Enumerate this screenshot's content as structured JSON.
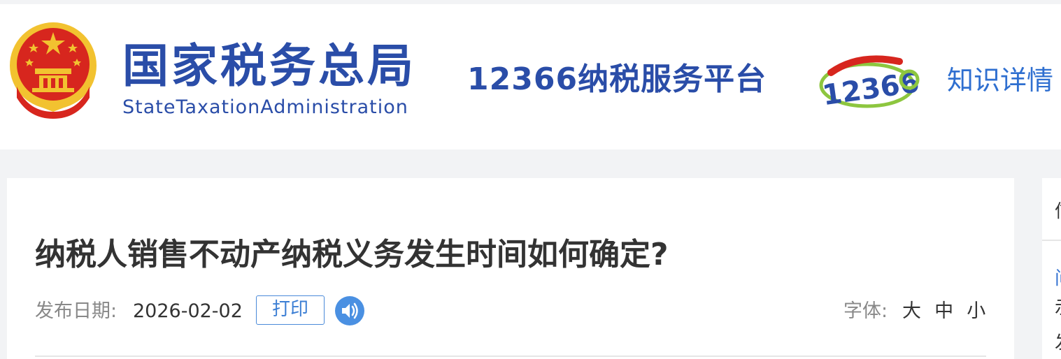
{
  "header": {
    "brand_cn": "国家税务总局",
    "brand_en": "StateTaxationAdministration",
    "platform": "12366纳税服务平台",
    "logo_text": "12366",
    "link": "知识详情"
  },
  "article": {
    "title": "纳税人销售不动产纳税义务发生时间如何确定?",
    "publish_label": "发布日期:",
    "publish_date": "2026-02-02",
    "print_label": "打印",
    "font_label": "字体:",
    "font_sizes": [
      "大",
      "中",
      "小"
    ]
  },
  "sidebar": {
    "fragments": [
      "信",
      "问",
      "示",
      "发"
    ]
  },
  "colors": {
    "brand": "#2a4da8",
    "link": "#2f6fd0",
    "accent": "#4a8ad9",
    "emblem_red": "#d7261e",
    "emblem_gold": "#f2c230"
  },
  "icons": {
    "emblem": "national-emblem-icon",
    "logo": "12366-logo-icon",
    "speaker": "speaker-icon"
  }
}
